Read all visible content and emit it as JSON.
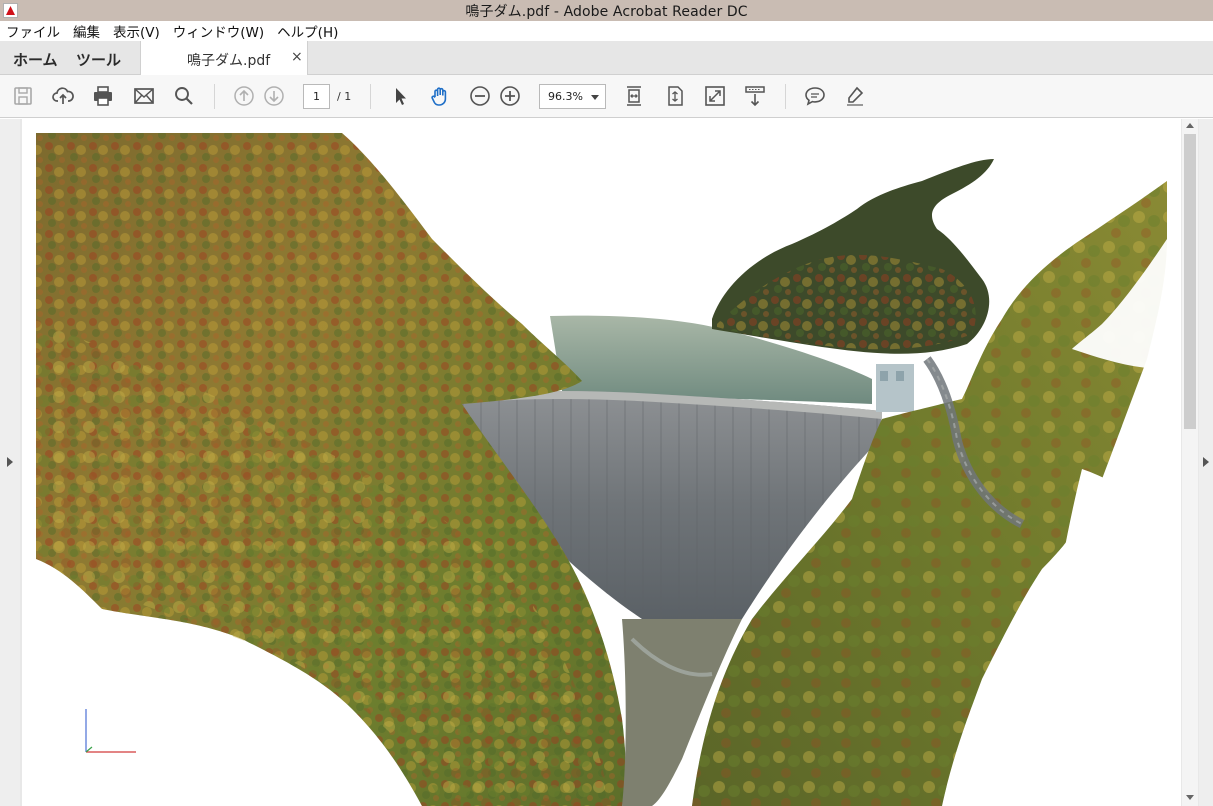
{
  "window": {
    "title": "鳴子ダム.pdf - Adobe Acrobat Reader DC"
  },
  "menu": {
    "items": [
      "ファイル",
      "編集",
      "表示(V)",
      "ウィンドウ(W)",
      "ヘルプ(H)"
    ]
  },
  "tabs": {
    "home": "ホーム",
    "tools": "ツール",
    "document": "鳴子ダム.pdf",
    "close": "×"
  },
  "toolbar": {
    "page_current": "1",
    "page_total": "/ 1",
    "zoom": "96.3%",
    "icons": [
      "save-icon",
      "upload-icon",
      "print-icon",
      "email-icon",
      "search-icon",
      "prev-page-icon",
      "next-page-icon",
      "select-cursor-icon",
      "hand-tool-icon",
      "zoom-out-icon",
      "zoom-in-icon",
      "fit-width-icon",
      "fit-page-icon",
      "fullscreen-icon",
      "scroll-mode-icon",
      "comment-icon",
      "highlight-icon"
    ]
  },
  "document": {
    "content": "3D point-cloud render of dam in autumn gorge"
  }
}
